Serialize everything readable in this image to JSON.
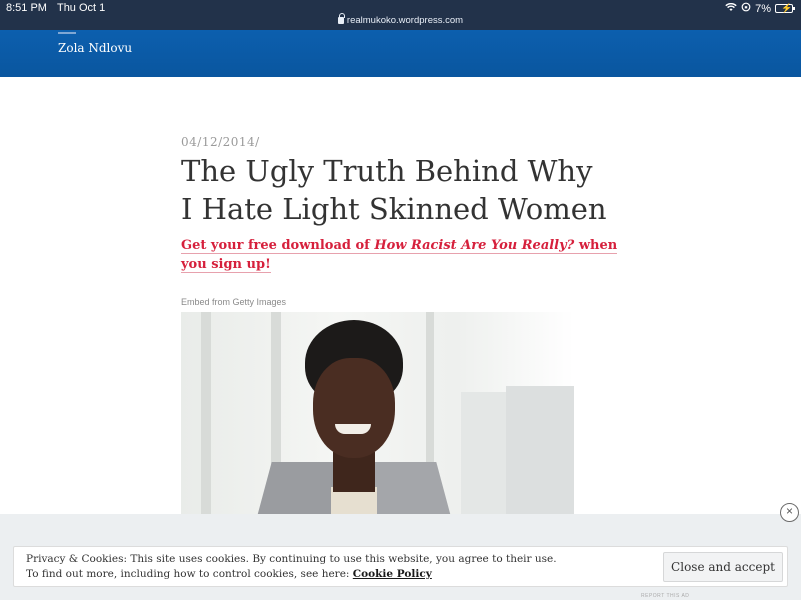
{
  "status_bar": {
    "time": "8:51 PM",
    "date": "Thu Oct 1",
    "battery": "7%",
    "url": "realmukoko.wordpress.com"
  },
  "site": {
    "title": "Zola Ndlovu",
    "header_color": "#0a5ba8"
  },
  "post": {
    "date": "04/12/2014",
    "date_separator": "/",
    "title": "The Ugly Truth Behind Why I Hate Light Skinned Women",
    "promo_prefix": "Get your free download of ",
    "promo_book": "How Racist Are You Really?",
    "promo_suffix": " when you sign up!",
    "promo_color": "#d6203c",
    "embed_label": "Embed from Getty Images"
  },
  "cookie_banner": {
    "line1": "Privacy & Cookies: This site uses cookies. By continuing to use this website, you agree to their use.",
    "line2_prefix": "To find out more, including how to control cookies, see here: ",
    "policy_link": "Cookie Policy",
    "accept_button": "Close and accept",
    "report_ad": "REPORT THIS AD"
  },
  "icons": {
    "close_ad": "×"
  }
}
